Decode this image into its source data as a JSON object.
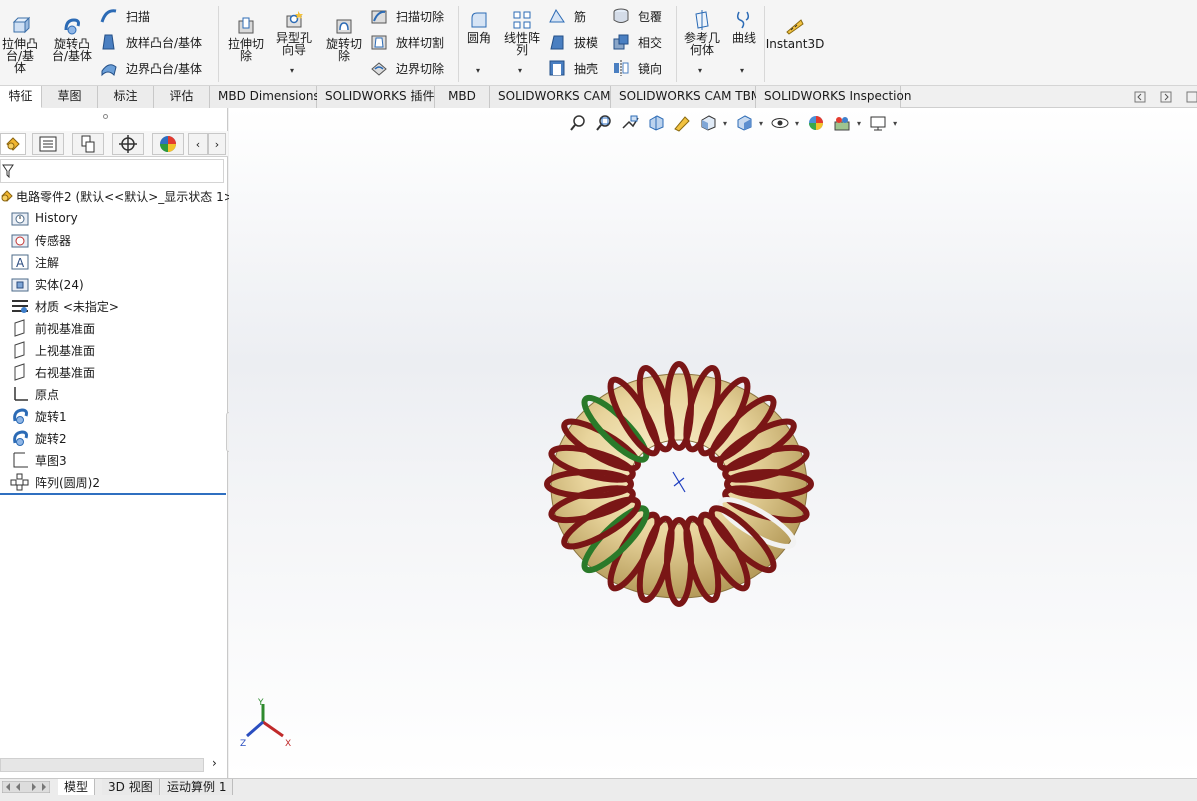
{
  "ribbon": {
    "extrude_boss": "拉伸凸\n台/基体",
    "revolve_boss": "旋转凸\n台/基体",
    "sweep": "扫描",
    "loft_boss": "放样凸台/基体",
    "boundary_boss": "边界凸台/基体",
    "extrude_cut": "拉伸切\n除",
    "hole_wizard": "异型孔\n向导",
    "revolve_cut": "旋转切\n除",
    "sweep_cut": "扫描切除",
    "loft_cut": "放样切割",
    "boundary_cut": "边界切除",
    "fillet": "圆角",
    "linear_pattern": "线性阵\n列",
    "rib": "筋",
    "draft": "拔模",
    "shell": "抽壳",
    "wrap": "包覆",
    "intersect": "相交",
    "mirror": "镜向",
    "ref_geometry": "参考几\n何体",
    "curves": "曲线",
    "instant3d": "Instant3D"
  },
  "tabs": [
    "特征",
    "草图",
    "标注",
    "评估",
    "MBD Dimensions",
    "SOLIDWORKS 插件",
    "MBD",
    "SOLIDWORKS CAM",
    "SOLIDWORKS CAM TBM",
    "SOLIDWORKS Inspection"
  ],
  "tree": {
    "root": "电路零件2 (默认<<默认>_显示状态 1>",
    "items": [
      {
        "label": "History",
        "icon": "history-folder-icon"
      },
      {
        "label": "传感器",
        "icon": "sensor-icon"
      },
      {
        "label": "注解",
        "icon": "annotation-icon"
      },
      {
        "label": "实体(24)",
        "icon": "solid-bodies-icon"
      },
      {
        "label": "材质 <未指定>",
        "icon": "material-icon"
      },
      {
        "label": "前视基准面",
        "icon": "plane-icon"
      },
      {
        "label": "上视基准面",
        "icon": "plane-icon"
      },
      {
        "label": "右视基准面",
        "icon": "plane-icon"
      },
      {
        "label": "原点",
        "icon": "origin-icon"
      },
      {
        "label": "旋转1",
        "icon": "revolve-icon"
      },
      {
        "label": "旋转2",
        "icon": "revolve-icon"
      },
      {
        "label": "草图3",
        "icon": "sketch-icon"
      },
      {
        "label": "阵列(圆周)2",
        "icon": "circular-pattern-icon"
      }
    ]
  },
  "triad": {
    "x": "X",
    "y": "Y",
    "z": "Z"
  },
  "bottom_tabs": [
    "模型",
    "3D 视图",
    "运动算例 1"
  ],
  "colors": {
    "copper": "#7a1616",
    "green": "#2a7a2a",
    "white": "#f2f2f2",
    "core": "#e8d49c",
    "accent": "#2f6fc0"
  }
}
